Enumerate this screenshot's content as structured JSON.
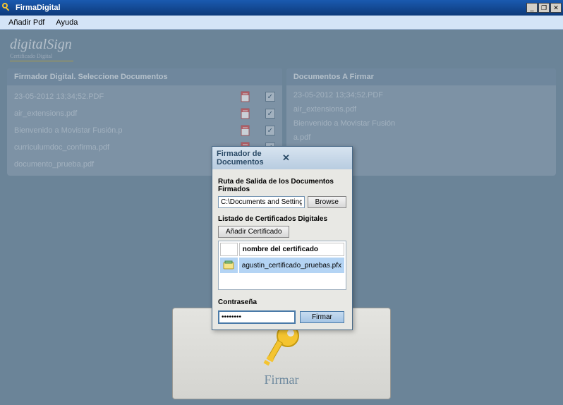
{
  "window": {
    "title": "FirmaDigital"
  },
  "menu": {
    "add_pdf": "Añadir Pdf",
    "help": "Ayuda"
  },
  "logo": {
    "main": "digitalSign",
    "sub": "Certificado Digital"
  },
  "left_panel": {
    "title": "Firmador Digital. Seleccione Documentos",
    "files": [
      {
        "name": "23-05-2012 13;34;52.PDF",
        "checked": true
      },
      {
        "name": "air_extensions.pdf",
        "checked": true
      },
      {
        "name": "Bienvenido a Movistar Fusión.p",
        "checked": true
      },
      {
        "name": "curriculumdoc_confirma.pdf",
        "checked": true
      },
      {
        "name": "documento_prueba.pdf",
        "checked": false
      }
    ]
  },
  "right_panel": {
    "title": "Documentos A Firmar",
    "files": [
      {
        "name": "23-05-2012 13;34;52.PDF"
      },
      {
        "name": "air_extensions.pdf"
      },
      {
        "name": "Bienvenido a Movistar Fusión"
      },
      {
        "name": "a.pdf"
      }
    ]
  },
  "sign_button": {
    "label": "Firmar"
  },
  "dialog": {
    "title": "Firmador de Documentos",
    "output_label": "Ruta de Salida de los Documentos Firmados",
    "output_path": "C:\\Documents and Settings\\Jo",
    "browse": "Browse",
    "cert_list_label": "Listado de Certificados Digitales",
    "add_cert": "Añadir Certificado",
    "cert_col": "nombre del certificado",
    "cert_name": "agustin_certificado_pruebas.pfx",
    "password_label": "Contraseña",
    "password_value": "********",
    "sign": "Firmar"
  }
}
